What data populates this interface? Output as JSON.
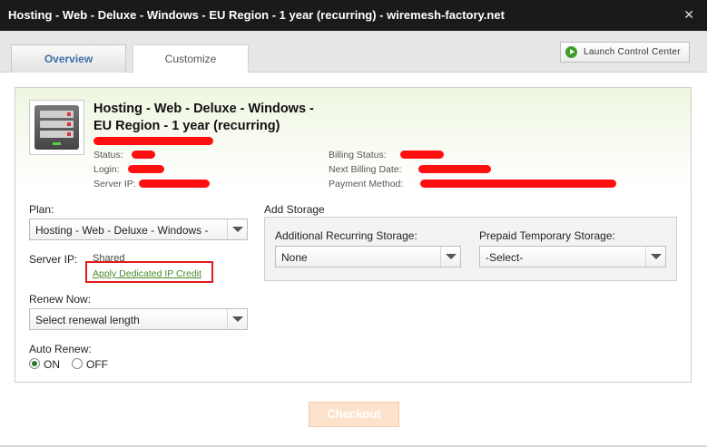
{
  "window": {
    "title": "Hosting - Web - Deluxe - Windows - EU Region - 1 year (recurring) - wiremesh-factory.net",
    "close_glyph": "✕"
  },
  "tabs": [
    {
      "label": "Overview",
      "active": false
    },
    {
      "label": "Customize",
      "active": true
    }
  ],
  "launch_button": {
    "label": "Launch Control Center",
    "icon": "play-circle-icon",
    "icon_color": "#3f9d2a"
  },
  "product": {
    "title_line1": "Hosting - Web - Deluxe - Windows -",
    "title_line2": "EU Region - 1 year (recurring)",
    "status_label": "Status:",
    "login_label": "Login:",
    "server_ip_label": "Server IP:",
    "billing_status_label": "Billing Status:",
    "next_billing_label": "Next Billing Date:",
    "payment_method_label": "Payment Method:"
  },
  "plan": {
    "label": "Plan:",
    "selected": "Hosting - Web - Deluxe - Windows -"
  },
  "server_ip": {
    "label": "Server IP:",
    "value": "Shared",
    "link_label": "Apply Dedicated IP Credit"
  },
  "renew_now": {
    "label": "Renew Now:",
    "selected": "Select renewal length"
  },
  "auto_renew": {
    "label": "Auto Renew:",
    "options": [
      {
        "label": "ON",
        "checked": true
      },
      {
        "label": "OFF",
        "checked": false
      }
    ]
  },
  "storage": {
    "title": "Add Storage",
    "additional": {
      "label": "Additional Recurring Storage:",
      "selected": "None"
    },
    "prepaid": {
      "label": "Prepaid Temporary Storage:",
      "selected": "-Select-"
    }
  },
  "checkout_label": "Checkout",
  "colors": {
    "titlebar": "#1a1a1a",
    "accent_green": "#4a8a2a",
    "redaction": "#ff0f0f",
    "highlight": "#e01b1b",
    "checkout": "#fde3cc"
  }
}
